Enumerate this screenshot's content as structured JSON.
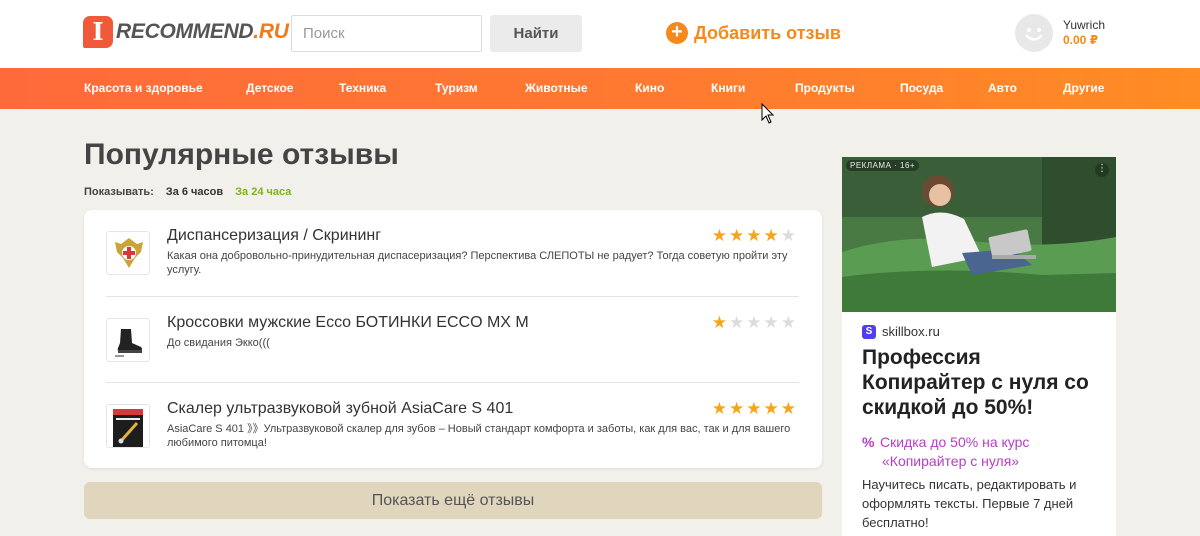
{
  "header": {
    "logo": {
      "badge": "I",
      "text_main": "RECOMMEND",
      "text_suffix": ".RU"
    },
    "search": {
      "placeholder": "Поиск",
      "button_label": "Найти"
    },
    "add_review_label": "Добавить отзыв",
    "user": {
      "name": "Yuwrich",
      "balance": "0.00 ₽"
    }
  },
  "nav": {
    "items": [
      {
        "label": "Красота и здоровье"
      },
      {
        "label": "Детское"
      },
      {
        "label": "Техника"
      },
      {
        "label": "Туризм"
      },
      {
        "label": "Животные"
      },
      {
        "label": "Кино"
      },
      {
        "label": "Книги"
      },
      {
        "label": "Продукты"
      },
      {
        "label": "Посуда"
      },
      {
        "label": "Авто"
      },
      {
        "label": "Другие"
      }
    ]
  },
  "main": {
    "title": "Популярные отзывы",
    "filter": {
      "label": "Показывать:",
      "options": [
        {
          "label": "За 6 часов",
          "active": false
        },
        {
          "label": "За 24 часа",
          "active": true
        }
      ]
    },
    "reviews": [
      {
        "title": "Диспансеризация / Скрининг",
        "text": "Какая она добровольно-принудительная диспасеризация? Перспектива СЛЕПОТЫ не радует? Тогда советую пройти эту услугу.",
        "rating": 4,
        "thumb_icon": "coat-of-arms-icon"
      },
      {
        "title": "Кроссовки мужские Ecco БОТИНКИ ECCO MX M",
        "text": "До свидания Экко(((",
        "rating": 1,
        "thumb_icon": "boot-icon"
      },
      {
        "title": "Скалер ультразвуковой зубной AsiaCare S 401",
        "text": "AsiaCare S 401 》》Ультразвуковой скалер для зубов – Новый стандарт комфорта и заботы, как для вас, так и для вашего любимого питомца!",
        "rating": 5,
        "thumb_icon": "scaler-box-icon"
      }
    ],
    "more_button_label": "Показать ещё отзывы"
  },
  "ad": {
    "tag": "РЕКЛАМА · 16+",
    "dots": "⋮",
    "brand": "skillbox.ru",
    "brand_icon_letter": "S",
    "headline": "Профессия Копирайтер с нуля со скидкой до 50%!",
    "promo_line1": "Скидка до 50% на курс",
    "promo_line2": "«Копирайтер с нуля»",
    "promo_icon": "%",
    "description": "Научитесь писать, редактировать и оформлять тексты. Первые 7 дней бесплатно!"
  },
  "colors": {
    "accent_orange": "#f5891a",
    "nav_gradient_start": "#ff6a3a",
    "nav_gradient_end": "#ff8c24",
    "active_filter": "#7bb51b",
    "star_on": "#f7a41a",
    "star_off": "#dcdcdc",
    "promo_purple": "#b63ec2"
  }
}
